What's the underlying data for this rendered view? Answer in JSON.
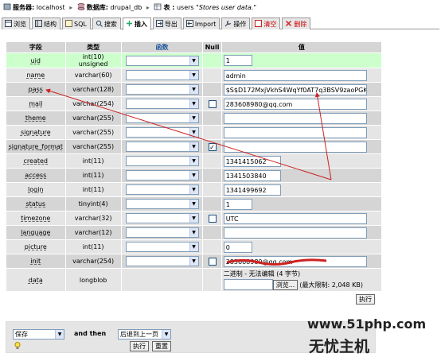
{
  "breadcrumb": {
    "server_label": "服务器:",
    "server": "localhost",
    "db_label": "数据库:",
    "db": "drupal_db",
    "table_label": "表 :",
    "table": "users",
    "comment": "\"Stores user data.\""
  },
  "tabs": [
    {
      "label": "浏览"
    },
    {
      "label": "结构"
    },
    {
      "label": "SQL"
    },
    {
      "label": "搜索"
    },
    {
      "label": "插入"
    },
    {
      "label": "导出"
    },
    {
      "label": "Import"
    },
    {
      "label": "操作"
    },
    {
      "label": "清空"
    },
    {
      "label": "删除"
    }
  ],
  "headers": {
    "field": "字段",
    "type": "类型",
    "function": "函数",
    "null": "Null",
    "value": "值"
  },
  "rows": [
    {
      "field": "uid",
      "type": "int(10) unsigned",
      "value": "1"
    },
    {
      "field": "name",
      "type": "varchar(60)",
      "value": "admin"
    },
    {
      "field": "pass",
      "type": "varchar(128)",
      "value": "$S$D172MxjVkhS4WqYf0AT7q3BSV9zaoPGK"
    },
    {
      "field": "mail",
      "type": "varchar(254)",
      "value": "283608980@qq.com"
    },
    {
      "field": "theme",
      "type": "varchar(255)",
      "value": ""
    },
    {
      "field": "signature",
      "type": "varchar(255)",
      "value": ""
    },
    {
      "field": "signature_format",
      "type": "varchar(255)",
      "value": ""
    },
    {
      "field": "created",
      "type": "int(11)",
      "value": "1341415062"
    },
    {
      "field": "access",
      "type": "int(11)",
      "value": "1341503840"
    },
    {
      "field": "login",
      "type": "int(11)",
      "value": "1341499692"
    },
    {
      "field": "status",
      "type": "tinyint(4)",
      "value": "1"
    },
    {
      "field": "timezone",
      "type": "varchar(32)",
      "value": "UTC"
    },
    {
      "field": "language",
      "type": "varchar(12)",
      "value": ""
    },
    {
      "field": "picture",
      "type": "int(11)",
      "value": "0"
    },
    {
      "field": "init",
      "type": "varchar(254)",
      "value": "283608980@qq.com"
    },
    {
      "field": "data",
      "type": "longblob",
      "value": ""
    }
  ],
  "blob": {
    "note": "二进制 - 无法编辑 (4 字节)",
    "browse": "浏览...",
    "limit": "(最大限制: 2,048 KB)"
  },
  "go_label": "执行",
  "footer": {
    "save_option": "保存",
    "and_then": "and then",
    "after_option": "后退到上一页",
    "go": "执行",
    "reset": "重置"
  },
  "watermark": {
    "line1": "www.51php.com",
    "line2": "无忧主机"
  },
  "colors": {
    "accent_red": "#cc2222",
    "highlight_row": "#ccffcc"
  }
}
